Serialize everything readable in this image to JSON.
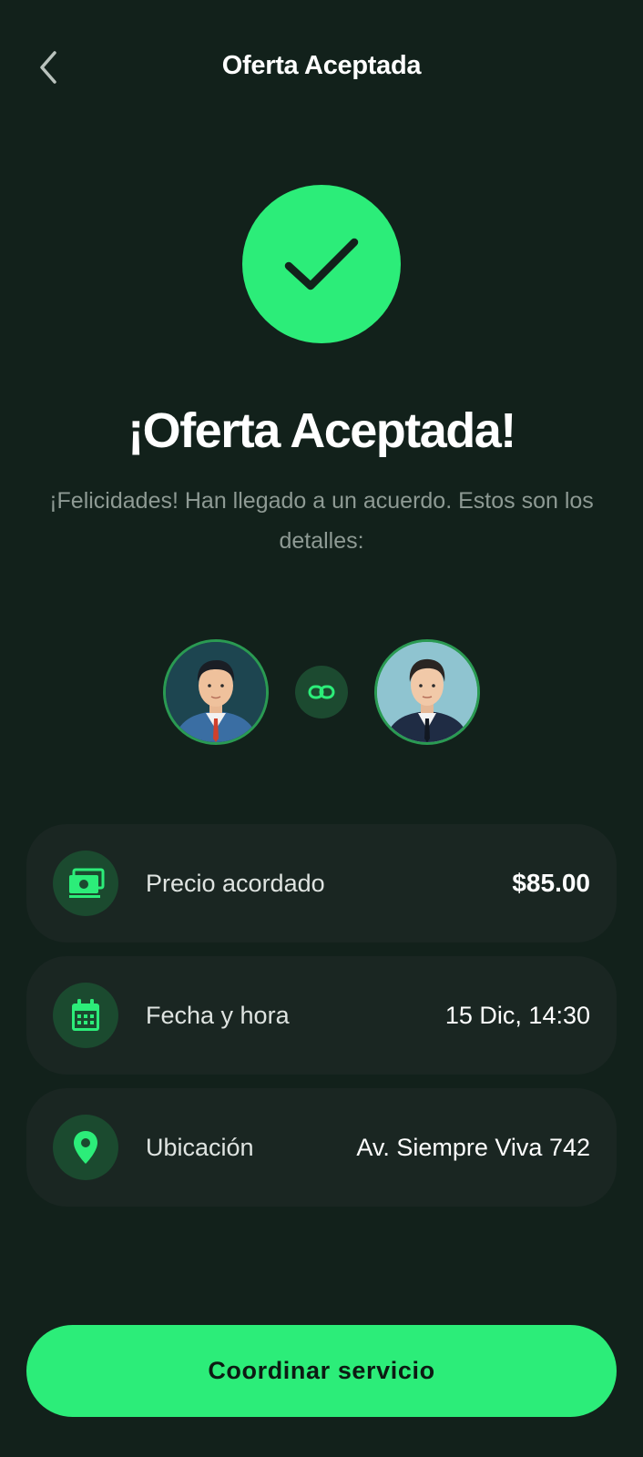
{
  "header": {
    "title": "Oferta Aceptada",
    "back_icon": "chevron-left-icon"
  },
  "hero": {
    "icon": "checkmark-icon",
    "title": "¡Oferta Aceptada!",
    "subtitle": "¡Felicidades! Han llegado a un acuerdo. Estos son los detalles:"
  },
  "participants": {
    "left_avatar": "avatar-man-red-tie",
    "link_icon": "link-icon",
    "right_avatar": "avatar-man-black-tie"
  },
  "details": [
    {
      "icon": "money-icon",
      "label": "Precio acordado",
      "value": "$85.00"
    },
    {
      "icon": "calendar-icon",
      "label": "Fecha y hora",
      "value": "15 Dic, 14:30"
    },
    {
      "icon": "location-pin-icon",
      "label": "Ubicación",
      "value": "Av. Siempre Viva 742"
    }
  ],
  "cta": {
    "label": "Coordinar servicio"
  },
  "colors": {
    "background": "#12211b",
    "accent": "#2ced79",
    "card": "#1a2622",
    "icon_bg": "#1b4a2f"
  }
}
